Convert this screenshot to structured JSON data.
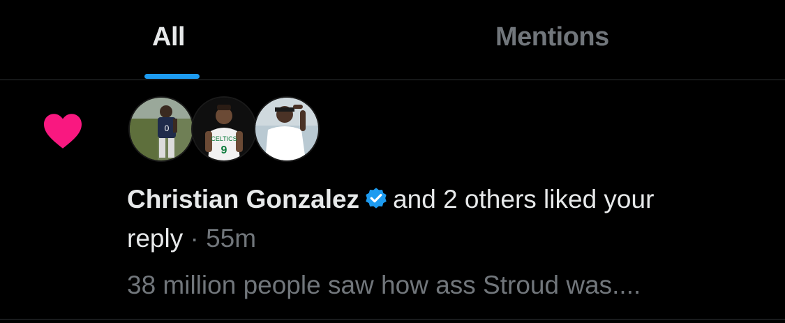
{
  "tabs": {
    "all": "All",
    "mentions": "Mentions",
    "active": "All"
  },
  "colors": {
    "accent": "#1d9bf0",
    "like": "#f91880",
    "verified": "#1d9bf0",
    "muted": "#71767b",
    "text": "#e7e9ea",
    "background": "#000000"
  },
  "notification": {
    "type_icon": "heart-icon",
    "avatars": [
      "avatar-user-1",
      "avatar-user-2",
      "avatar-user-3"
    ],
    "actor_name": "Christian Gonzalez",
    "verified_icon": "verified-badge-icon",
    "action_text_1": "and 2 others liked your",
    "action_text_2": "reply",
    "separator": " · ",
    "time": "55m",
    "preview": "38 million people saw how ass Stroud was...."
  }
}
